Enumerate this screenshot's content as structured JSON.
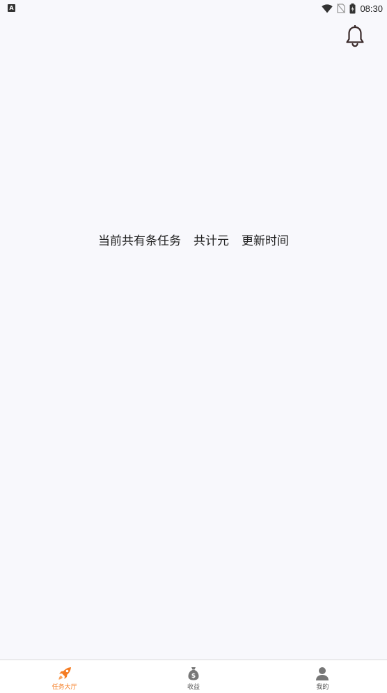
{
  "status_bar": {
    "time": "08:30",
    "left_icon": "A"
  },
  "header": {
    "notification_icon": "bell-icon"
  },
  "summary": {
    "task_count_text": "当前共有条任务",
    "total_amount_text": "共计元",
    "update_time_text": "更新时间"
  },
  "bottom_nav": {
    "items": [
      {
        "label": "任务大厅",
        "icon": "rocket-icon",
        "active": true
      },
      {
        "label": "收益",
        "icon": "money-bag-icon",
        "active": false
      },
      {
        "label": "我的",
        "icon": "user-icon",
        "active": false
      }
    ]
  },
  "colors": {
    "accent": "#f57c22",
    "background": "#f8f8fc",
    "nav_inactive": "#777777"
  }
}
